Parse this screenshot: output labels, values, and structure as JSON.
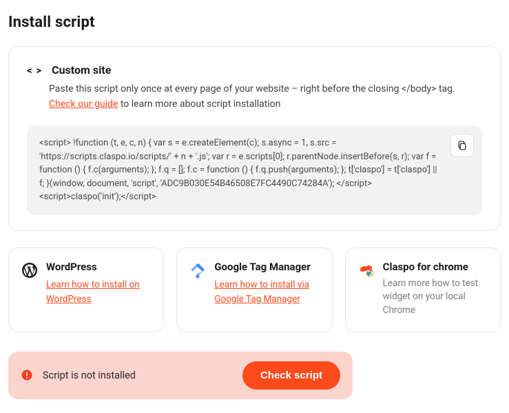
{
  "page_title": "Install script",
  "custom": {
    "title": "Custom site",
    "desc_before": "Paste this script only once at every page of your website – right before the closing </body> tag. ",
    "link": "Check our guide",
    "desc_after": " to learn more about script installation",
    "script_code": "<script> !function (t, e, c, n) { var s = e.createElement(c); s.async = 1, s.src = 'https://scripts.claspo.io/scripts/' + n + '.js'; var r = e.scripts[0]; r.parentNode.insertBefore(s, r); var f = function () { f.c(arguments); }; f.q = []; f.c = function () { f.q.push(arguments); }; t['claspo'] = t['claspo'] || f; }(window, document, 'script', 'ADC9B030E54B46508E7FC4490C74284A'); </script><script>claspo('init');</script>"
  },
  "tiles": {
    "wordpress": {
      "title": "WordPress",
      "link": "Learn how to install on WordPress"
    },
    "gtm": {
      "title": "Google Tag Manager",
      "link": "Learn how to install via Google Tag Manager"
    },
    "chrome": {
      "title": "Claspo for chrome",
      "text": "Learn more how to test widget on your local Chrome"
    }
  },
  "status": {
    "text": "Script is not installed",
    "button": "Check script"
  }
}
